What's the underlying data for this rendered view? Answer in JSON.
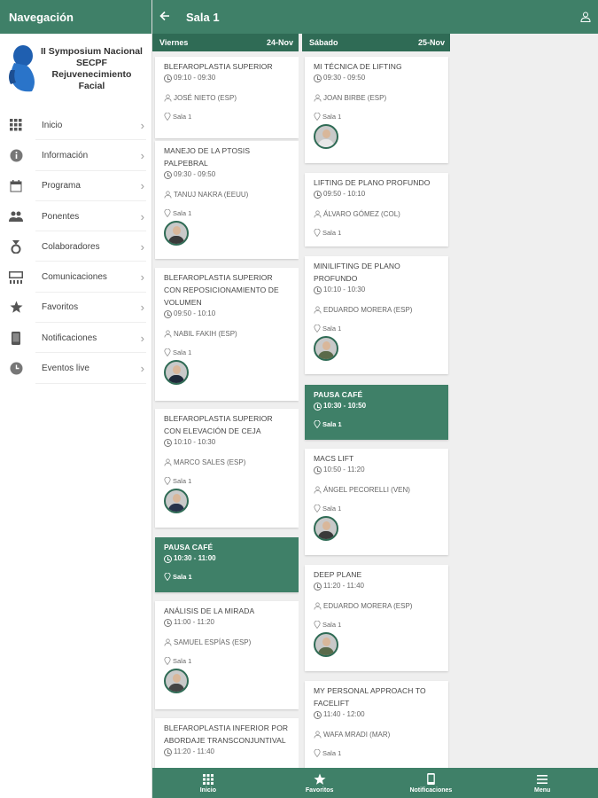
{
  "sidebar": {
    "title": "Navegación",
    "logo_lines": [
      "II Symposium Nacional",
      "SECPF",
      "Rejuvenecimiento",
      "Facial"
    ],
    "items": [
      {
        "label": "Inicio",
        "icon": "grid-icon"
      },
      {
        "label": "Información",
        "icon": "info-icon"
      },
      {
        "label": "Programa",
        "icon": "calendar-icon"
      },
      {
        "label": "Ponentes",
        "icon": "people-icon"
      },
      {
        "label": "Colaboradores",
        "icon": "medal-icon"
      },
      {
        "label": "Comunicaciones",
        "icon": "presentation-icon"
      },
      {
        "label": "Favoritos",
        "icon": "star-icon"
      },
      {
        "label": "Notificaciones",
        "icon": "phone-icon"
      },
      {
        "label": "Eventos live",
        "icon": "clock-icon"
      }
    ]
  },
  "topbar": {
    "title": "Sala 1"
  },
  "days": [
    {
      "name": "Viernes",
      "date": "24-Nov",
      "sessions": [
        {
          "title": "BLEFAROPLASTIA SUPERIOR",
          "time": "09:10 - 09:30",
          "speaker": "JOSÉ NIETO (ESP)",
          "room": "Sala 1",
          "avatar": false,
          "break": false
        },
        {
          "title": "MANEJO DE LA PTOSIS PALPEBRAL",
          "time": "09:30 - 09:50",
          "speaker": "TANUJ NAKRA (EEUU)",
          "room": "Sala 1",
          "avatar": true,
          "break": false
        },
        {
          "title": "BLEFAROPLASTIA SUPERIOR CON REPOSICIONAMIENTO DE VOLUMEN",
          "time": "09:50 - 10:10",
          "speaker": "NABIL FAKIH (ESP)",
          "room": "Sala 1",
          "avatar": true,
          "break": false
        },
        {
          "title": "BLEFAROPLASTIA SUPERIOR CON ELEVACIÓN DE CEJA",
          "time": "10:10 - 10:30",
          "speaker": "MARCO SALES (ESP)",
          "room": "Sala 1",
          "avatar": true,
          "break": false
        },
        {
          "title": "PAUSA CAFÉ",
          "time": "10:30 - 11:00",
          "speaker": "",
          "room": "Sala 1",
          "avatar": false,
          "break": true
        },
        {
          "title": "ANÁLISIS DE LA MIRADA",
          "time": "11:00 - 11:20",
          "speaker": "SAMUEL ESPÍAS (ESP)",
          "room": "Sala 1",
          "avatar": true,
          "break": false
        },
        {
          "title": "BLEFAROPLASTIA INFERIOR POR ABORDAJE TRANSCONJUNTIVAL",
          "time": "11:20 - 11:40",
          "speaker": "",
          "room": "",
          "avatar": false,
          "break": false
        }
      ]
    },
    {
      "name": "Sábado",
      "date": "25-Nov",
      "sessions": [
        {
          "title": "MI TÉCNICA DE LIFTING",
          "time": "09:30 - 09:50",
          "speaker": "JOAN BIRBE (ESP)",
          "room": "Sala 1",
          "avatar": true,
          "break": false
        },
        {
          "title": "LIFTING DE PLANO PROFUNDO",
          "time": "09:50 - 10:10",
          "speaker": "ÁLVARO GÓMEZ (COL)",
          "room": "Sala 1",
          "avatar": false,
          "break": false
        },
        {
          "title": "MINILIFTING DE PLANO PROFUNDO",
          "time": "10:10 - 10:30",
          "speaker": "EDUARDO MORERA (ESP)",
          "room": "Sala 1",
          "avatar": true,
          "break": false
        },
        {
          "title": "PAUSA CAFÉ",
          "time": "10:30 - 10:50",
          "speaker": "",
          "room": "Sala 1",
          "avatar": false,
          "break": true
        },
        {
          "title": "MACS LIFT",
          "time": "10:50 - 11:20",
          "speaker": "ÁNGEL PECORELLI (VEN)",
          "room": "Sala 1",
          "avatar": true,
          "break": false
        },
        {
          "title": "DEEP PLANE",
          "time": "11:20 - 11:40",
          "speaker": "EDUARDO MORERA (ESP)",
          "room": "Sala 1",
          "avatar": true,
          "break": false
        },
        {
          "title": "MY PERSONAL APPROACH TO FACELIFT",
          "time": "11:40 - 12:00",
          "speaker": "WAFA MRADI (MAR)",
          "room": "Sala 1",
          "avatar": false,
          "break": false
        }
      ]
    }
  ],
  "bottombar": {
    "items": [
      {
        "label": "Inicio",
        "icon": "grid-icon"
      },
      {
        "label": "Favoritos",
        "icon": "star-icon"
      },
      {
        "label": "Notificaciones",
        "icon": "phone-icon"
      },
      {
        "label": "Menu",
        "icon": "menu-icon"
      }
    ]
  },
  "colors": {
    "primary": "#3f8068",
    "header_dark": "#2f6b55"
  }
}
